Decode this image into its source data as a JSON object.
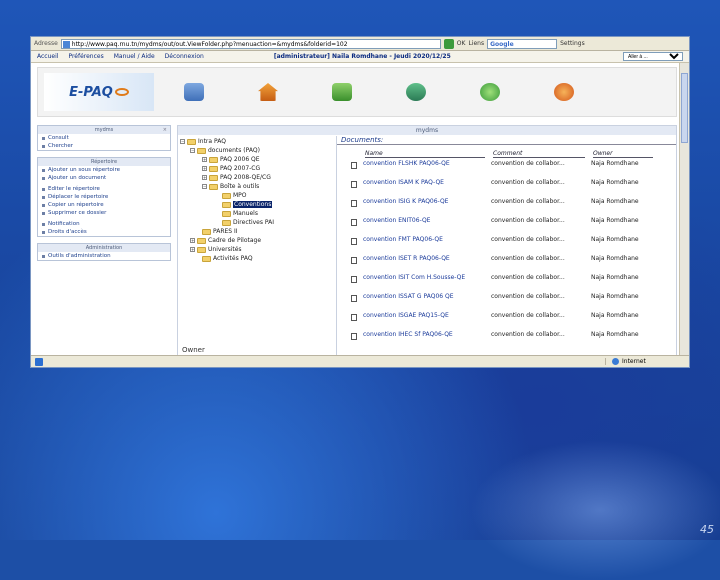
{
  "browser": {
    "address_label": "Adresse",
    "url": "http://www.paq.rnu.tn/mydms/out/out.ViewFolder.php?menuaction=&mydms&folderid=102",
    "go_label": "OK",
    "links_label": "Liens",
    "google_label": "Google",
    "settings_label": "Settings",
    "status_text": "",
    "zone_label": "Internet"
  },
  "linkbar": {
    "items": [
      "Accueil",
      "Préférences",
      "Manuel / Aide",
      "Déconnexion"
    ],
    "user": "[administrateur] Naila Romdhane - Jeudi 2020/12/25",
    "select_value": "Aller à ..."
  },
  "header": {
    "logo_text": "E-PAQ",
    "icons": [
      "dashboard-icon",
      "home-icon",
      "mail-icon",
      "users-icon",
      "chat-icon",
      "power-icon"
    ]
  },
  "sidebar": {
    "box1": {
      "title": "mydms",
      "items": [
        "Consult",
        "Chercher"
      ]
    },
    "box2": {
      "title": "Répertoire",
      "items": [
        "Ajouter un sous répertoire",
        "Ajouter un document",
        "Editer le répertoire",
        "Déplacer le répertoire",
        "Copier un répertoire",
        "Supprimer ce dossier",
        "Notification",
        "Droits d'accès"
      ]
    },
    "box3": {
      "title": "Administration",
      "items": [
        "Outils d'administration"
      ]
    }
  },
  "main": {
    "title": "mydms",
    "tree": [
      {
        "label": "Intra PAQ",
        "pm": "−"
      },
      {
        "label": "documents (PAQ)",
        "pm": "−"
      },
      {
        "label": "PAQ 2006 QE",
        "pm": "+"
      },
      {
        "label": "PAQ 2007-CG",
        "pm": "+"
      },
      {
        "label": "PAQ 2008-QE/CG",
        "pm": "+"
      },
      {
        "label": "Boîte à outils",
        "pm": "−"
      },
      {
        "label": "MPO",
        "pm": ""
      },
      {
        "label": "Conventions",
        "pm": ""
      },
      {
        "label": "Manuels",
        "pm": ""
      },
      {
        "label": "Directives PAI",
        "pm": ""
      },
      {
        "label": "PARES II",
        "pm": ""
      },
      {
        "label": "Cadre de Pilotage",
        "pm": "+"
      },
      {
        "label": "Universités",
        "pm": "+"
      },
      {
        "label": "Activités PAQ",
        "pm": ""
      }
    ],
    "owner_label": "Owner",
    "documents_title": "Documents:",
    "columns": {
      "name": "Name",
      "comment": "Comment",
      "owner": "Owner"
    },
    "documents": [
      {
        "name": "convention FLSHK PAQ06-QE",
        "comment": "convention de collabor...",
        "owner": "Naja Romdhane"
      },
      {
        "name": "convention ISAM K PAQ-QE",
        "comment": "convention de collabor...",
        "owner": "Naja Romdhane"
      },
      {
        "name": "convention ISIG K PAQ06-QE",
        "comment": "convention de collabor...",
        "owner": "Naja Romdhane"
      },
      {
        "name": "convention ENIT06-QE",
        "comment": "convention de collabor...",
        "owner": "Naja Romdhane"
      },
      {
        "name": "convention FMT PAQ06-QE",
        "comment": "convention de collabor...",
        "owner": "Naja Romdhane"
      },
      {
        "name": "convention ISET R PAQ06-QE",
        "comment": "convention de collabor...",
        "owner": "Naja Romdhane"
      },
      {
        "name": "convention ISIT Com H.Sousse-QE",
        "comment": "convention de collabor...",
        "owner": "Naja Romdhane"
      },
      {
        "name": "convention ISSAT G PAQ06 QE",
        "comment": "convention de collabor...",
        "owner": "Naja Romdhane"
      },
      {
        "name": "convention ISGAE PAQ15-QE",
        "comment": "convention de collabor...",
        "owner": "Naja Romdhane"
      },
      {
        "name": "convention IHEC Sf PAQ06-QE",
        "comment": "convention de collabor...",
        "owner": "Naja Romdhane"
      }
    ]
  },
  "slide": {
    "page_number": "45"
  }
}
